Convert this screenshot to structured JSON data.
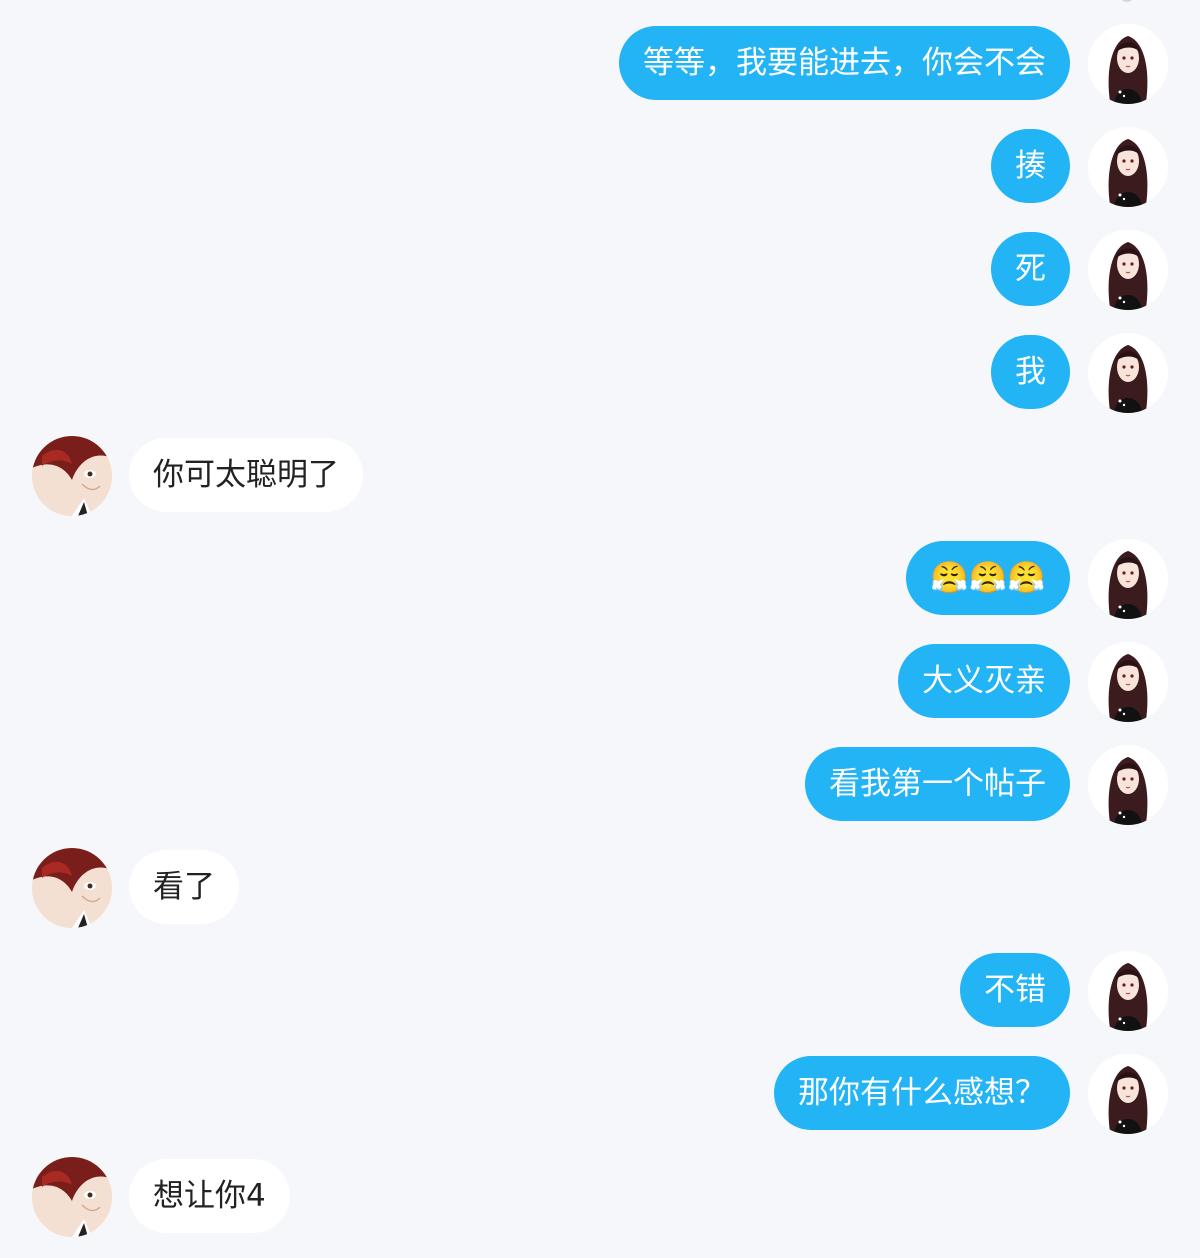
{
  "conversation": {
    "messages": [
      {
        "side": "me",
        "text": "等等，我要能进去，你会不会"
      },
      {
        "side": "me",
        "text": "揍"
      },
      {
        "side": "me",
        "text": "死"
      },
      {
        "side": "me",
        "text": "我"
      },
      {
        "side": "other",
        "text": "你可太聪明了"
      },
      {
        "side": "me",
        "text": "😤😤😤"
      },
      {
        "side": "me",
        "text": "大义灭亲"
      },
      {
        "side": "me",
        "text": "看我第一个帖子"
      },
      {
        "side": "other",
        "text": "看了"
      },
      {
        "side": "me",
        "text": "不错"
      },
      {
        "side": "me",
        "text": "那你有什么感想？"
      },
      {
        "side": "other",
        "text": "想让你4"
      }
    ]
  },
  "colors": {
    "background": "#f5f7fa",
    "my_bubble": "#22b4f5",
    "other_bubble": "#ffffff",
    "my_text": "#ffffff",
    "other_text": "#222222"
  },
  "icons": {
    "my_avatar": "avatar-long-dark-hair-girl",
    "other_avatar": "avatar-red-hair-boy"
  }
}
